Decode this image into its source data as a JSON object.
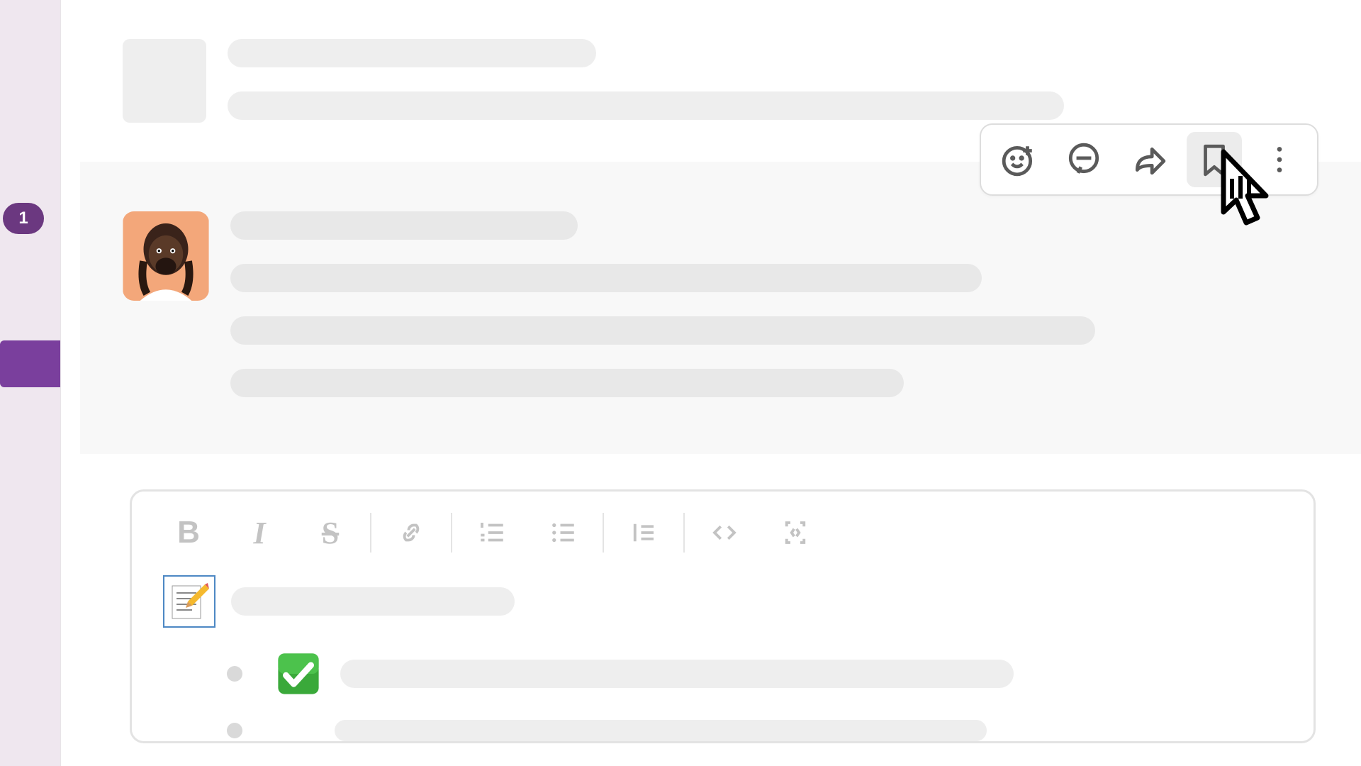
{
  "sidebar": {
    "badge_count": "1"
  },
  "message_actions": {
    "emoji": "add-reaction",
    "thread": "reply-in-thread",
    "share": "share-message",
    "bookmark": "save-to-later",
    "more": "more-actions"
  },
  "formatting": {
    "bold": "B",
    "italic": "I",
    "strike": "S"
  },
  "composer": {
    "emoji_memo": "📝",
    "emoji_check": "✅"
  }
}
